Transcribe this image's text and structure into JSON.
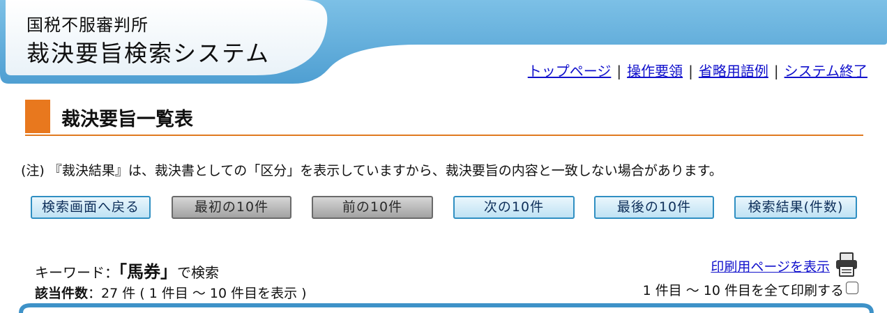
{
  "header": {
    "title_line1": "国税不服審判所",
    "title_line2": "裁決要旨検索システム",
    "colors": {
      "band": "#6fb3de",
      "band_light": "#cfe6f4"
    }
  },
  "nav": {
    "items": [
      "トップページ",
      "操作要領",
      "省略用語例",
      "システム終了"
    ],
    "separator": "|"
  },
  "section": {
    "title": "裁決要旨一覧表",
    "accent_color": "#e8781e"
  },
  "note": "(注) 『裁決結果』は、裁決書としての「区分」を表示していますから、裁決要旨の内容と一致しない場合があります。",
  "buttons": {
    "back_to_search": "検索画面へ戻る",
    "first_10": "最初の10件",
    "prev_10": "前の10件",
    "next_10": "次の10件",
    "last_10": "最後の10件",
    "results_count": "検索結果(件数)"
  },
  "search": {
    "keyword_label": "キーワード：",
    "keyword": "「馬券」",
    "keyword_suffix": "で検索",
    "count_label": "該当件数",
    "count_text": "：27 件 ( 1 件目 ～ 10 件目を表示 )"
  },
  "print": {
    "link_label": "印刷用ページを表示",
    "all_label": "1 件目 ～ 10 件目を全て印刷する",
    "printer_icon": "printer-icon",
    "checked": false
  }
}
